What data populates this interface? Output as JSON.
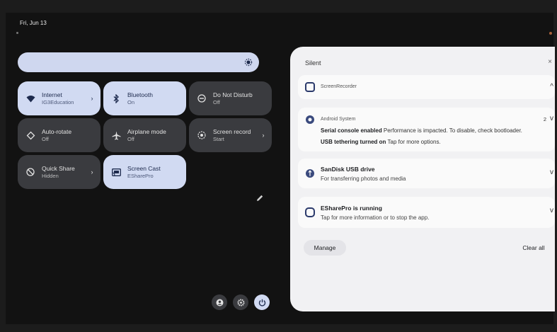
{
  "status": {
    "date": "Fri, Jun 13"
  },
  "quick_settings": {
    "tiles": [
      {
        "title": "Internet",
        "subtitle": "IG3Education",
        "state": "on",
        "icon": "wifi-icon",
        "has_chevron": true
      },
      {
        "title": "Bluetooth",
        "subtitle": "On",
        "state": "on",
        "icon": "bluetooth-icon",
        "has_chevron": false
      },
      {
        "title": "Do Not Disturb",
        "subtitle": "Off",
        "state": "off",
        "icon": "dnd-icon",
        "has_chevron": false
      },
      {
        "title": "Auto-rotate",
        "subtitle": "Off",
        "state": "off",
        "icon": "rotate-icon",
        "has_chevron": false
      },
      {
        "title": "Airplane mode",
        "subtitle": "Off",
        "state": "off",
        "icon": "airplane-icon",
        "has_chevron": false
      },
      {
        "title": "Screen record",
        "subtitle": "Start",
        "state": "off",
        "icon": "record-icon",
        "has_chevron": true
      },
      {
        "title": "Quick Share",
        "subtitle": "Hidden",
        "state": "off",
        "icon": "quick-share-icon",
        "has_chevron": true
      },
      {
        "title": "Screen Cast",
        "subtitle": "ESharePro",
        "state": "on",
        "icon": "cast-icon",
        "has_chevron": false
      }
    ],
    "colors": {
      "tile_on": "#d1daf2",
      "tile_off": "#3a3b3f",
      "background": "#121212"
    }
  },
  "notifications": {
    "section_title": "Silent",
    "close_glyph": "×",
    "items": [
      {
        "app": "ScreenRecorder",
        "expand_glyph": "^"
      },
      {
        "app": "Android System",
        "count": "2",
        "line1_bold": "Serial console enabled",
        "line1_rest": " Performance is impacted. To disable, check bootloader.",
        "line2_bold": "USB tethering turned on",
        "line2_rest": " Tap for more options.",
        "expand_glyph": "v"
      },
      {
        "title": "SanDisk USB drive",
        "body": "For transferring photos and media",
        "expand_glyph": "v"
      },
      {
        "title": "ESharePro is running",
        "body": "Tap for more information or to stop the app.",
        "expand_glyph": "v"
      }
    ],
    "manage_label": "Manage",
    "clear_all_label": "Clear all"
  }
}
